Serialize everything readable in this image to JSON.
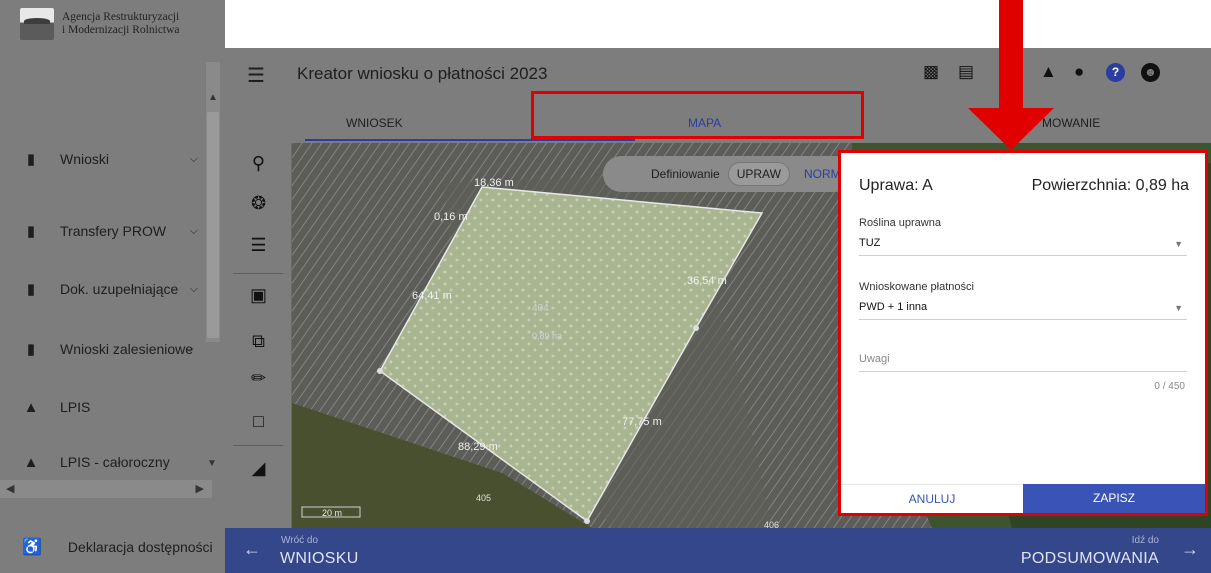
{
  "app": {
    "logo_line1": "Agencja Restrukturyzacji",
    "logo_line2": "i Modernizacji Rolnictwa",
    "title": "Kreator wniosku o płatności 2023"
  },
  "sidebar": {
    "items": [
      {
        "label": "Wnioski",
        "icon": "clipboard-icon",
        "has_chevron": true
      },
      {
        "label": "Transfery PROW",
        "icon": "clipboard-icon",
        "has_chevron": true
      },
      {
        "label": "Dok. uzupełniające",
        "icon": "clipboard-icon",
        "has_chevron": true
      },
      {
        "label": "Wnioski zalesieniowe",
        "icon": "clipboard-icon",
        "has_chevron": true
      },
      {
        "label": "LPIS",
        "icon": "mountain-icon",
        "has_chevron": false
      },
      {
        "label": "LPIS - całoroczny",
        "icon": "mountain-icon",
        "has_chevron": false
      }
    ],
    "footer_label": "Deklaracja dostępności"
  },
  "tabs": [
    {
      "label": "WNIOSEK"
    },
    {
      "label": "MAPA",
      "active": true
    },
    {
      "label": "PODSUMOWANIE",
      "visible_text": "MOWANIE"
    }
  ],
  "map": {
    "toggle_label": "Definiowanie",
    "toggle_selected": "UPRAW",
    "toggle_other": "NORM",
    "scale_label": "20 m",
    "parcel_label": "404",
    "parcel_area": "0,89 ha",
    "edge_labels": [
      "64,41 m",
      "36,54 m",
      "77,75 m",
      "88,29 m",
      "18,36 m",
      "0,16 m"
    ],
    "parcel_numbers": [
      "405",
      "406"
    ]
  },
  "panel": {
    "title": "Uprawa: A",
    "area": "Powierzchnia: 0,89 ha",
    "crop_label": "Roślina uprawna",
    "crop_value": "TUZ",
    "payments_label": "Wnioskowane płatności",
    "payments_value": "PWD + 1 inna",
    "notes_placeholder": "Uwagi",
    "notes_counter": "0 / 450",
    "cancel_label": "ANULUJ",
    "save_label": "ZAPISZ"
  },
  "bottom_bar": {
    "back_small": "Wróć do",
    "back_big": "WNIOSKU",
    "next_small": "Idź do",
    "next_big": "PODSUMOWANIA"
  },
  "colors": {
    "accent": "#2b3ea0",
    "highlight": "#e00000",
    "bottom_bar": "#34478a"
  }
}
